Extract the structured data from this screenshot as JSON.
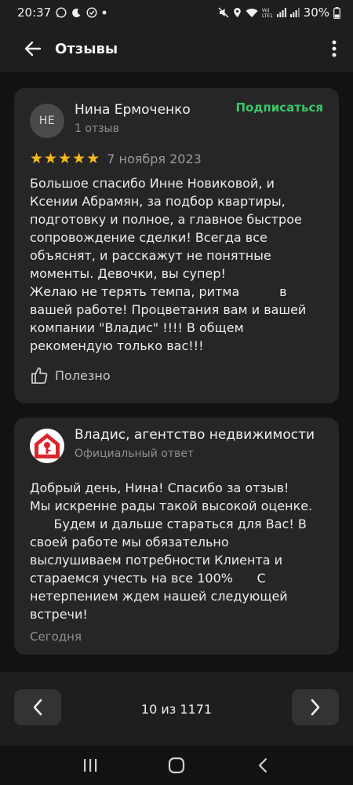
{
  "status_bar": {
    "time": "20:37",
    "battery": "30%",
    "network_label": "Vo)\nLTE1"
  },
  "app_bar": {
    "title": "Отзывы"
  },
  "review": {
    "avatar_initials": "НЕ",
    "author_name": "Нина Ермоченко",
    "author_reviews": "1 отзыв",
    "subscribe_label": "Подписаться",
    "rating": 5,
    "stars": [
      "★",
      "★",
      "★",
      "★",
      "★"
    ],
    "date": "7 ноября 2023",
    "text": "Большое спасибо Инне Новиковой, и\nКсении Абрамян, за подбор квартиры,\nподготовку и полное, а главное быстрое\nсопровождение сделки! Всегда все\nобъяснят, и расскажут не понятные\nмоменты. Девочки, вы супер!\nЖелаю не терять темпа, ритма          в\nвашей работе! Процветания вам и вашей\nкомпании \"Владис\" !!!! В общем\nрекомендую только вас!!!",
    "helpful_label": "Полезно"
  },
  "reply": {
    "company_name": "Владис, агентство недвижимости",
    "official_label": "Официальный ответ",
    "text": "Добрый день, Нина! Спасибо за отзыв!\nМы искренне рады такой высокой оценке.\n      Будем и дальше стараться для Вас! В\nсвоей работе мы обязательно\nвыслушиваем потребности Клиента и\nстараемся учесть на все 100%      С\nнетерпением ждем нашей следующей\nвстречи!",
    "date": "Сегодня"
  },
  "pager": {
    "label": "10 из 1171"
  },
  "colors": {
    "background": "#121212",
    "card": "#262626",
    "accent_green": "#3cc46a",
    "star": "#f5b81c",
    "brand_red": "#d9262c"
  },
  "icons": {
    "back": "arrow-left-icon",
    "more": "more-vertical-icon",
    "helpful": "thumbs-up-icon",
    "prev": "chevron-left-icon",
    "next": "chevron-right-icon",
    "nav_recents": "recents-icon",
    "nav_home": "home-icon",
    "nav_back": "nav-back-icon"
  }
}
